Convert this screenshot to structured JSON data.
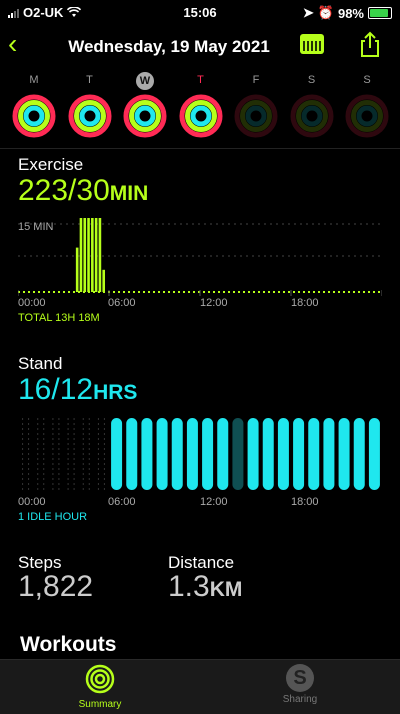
{
  "status_bar": {
    "carrier": "O2-UK",
    "time": "15:06",
    "battery": "98%",
    "battery_level": 0.98
  },
  "header": {
    "title": "Wednesday, 19 May 2021"
  },
  "week": [
    {
      "letter": "M",
      "state": "full"
    },
    {
      "letter": "T",
      "state": "full"
    },
    {
      "letter": "W",
      "state": "full",
      "today": true
    },
    {
      "letter": "T",
      "state": "full",
      "selected": true
    },
    {
      "letter": "F",
      "state": "empty"
    },
    {
      "letter": "S",
      "state": "empty"
    },
    {
      "letter": "S",
      "state": "empty"
    }
  ],
  "exercise": {
    "label": "Exercise",
    "value": "223/30",
    "unit": "MIN",
    "scale_label": "15 MIN",
    "axis": [
      "00:00",
      "06:00",
      "12:00",
      "18:00"
    ],
    "total": "TOTAL 13H 18M",
    "color": "#b6ff1a",
    "hourly_minutes": [
      1,
      1,
      1,
      1,
      1,
      1,
      1,
      1,
      1,
      1,
      1,
      1,
      1,
      1,
      1,
      18,
      30,
      30,
      30,
      30,
      30,
      30,
      9,
      1,
      1,
      1,
      1,
      1,
      1,
      1,
      1,
      1,
      1,
      1,
      1,
      1,
      1,
      1,
      1,
      1,
      1,
      1,
      1,
      1,
      1,
      1,
      1,
      1,
      1,
      1,
      1,
      1,
      1,
      1,
      1,
      1,
      1,
      1,
      1,
      1,
      1,
      1,
      1,
      1,
      1,
      1,
      1,
      1,
      1,
      1,
      1,
      1,
      1,
      1,
      1,
      1,
      1,
      1,
      1,
      1,
      1,
      1,
      1,
      1,
      1,
      1,
      1,
      1,
      1,
      1,
      1,
      1,
      1,
      1,
      1,
      1,
      1,
      1,
      1,
      1,
      1,
      1,
      1,
      1,
      1,
      1
    ]
  },
  "stand": {
    "label": "Stand",
    "value": "16/12",
    "unit": "HRS",
    "axis": [
      "00:00",
      "06:00",
      "12:00",
      "18:00"
    ],
    "idle": "1 IDLE HOUR",
    "color": "#1fe7ee",
    "hours": [
      0,
      0,
      0,
      0,
      0,
      0,
      1,
      1,
      1,
      1,
      1,
      1,
      1,
      1,
      2,
      1,
      1,
      1,
      1,
      1,
      1,
      1,
      1,
      1
    ]
  },
  "steps": {
    "label": "Steps",
    "value": "1,822"
  },
  "distance": {
    "label": "Distance",
    "value": "1.3",
    "unit": "KM"
  },
  "workouts": {
    "label": "Workouts"
  },
  "tabs": [
    {
      "label": "Summary",
      "active": true
    },
    {
      "label": "Sharing",
      "active": false
    }
  ],
  "colors": {
    "move": "#ff2b55",
    "exercise": "#b6ff1a",
    "stand": "#1fe7ee",
    "accent": "#b6ff1a"
  }
}
